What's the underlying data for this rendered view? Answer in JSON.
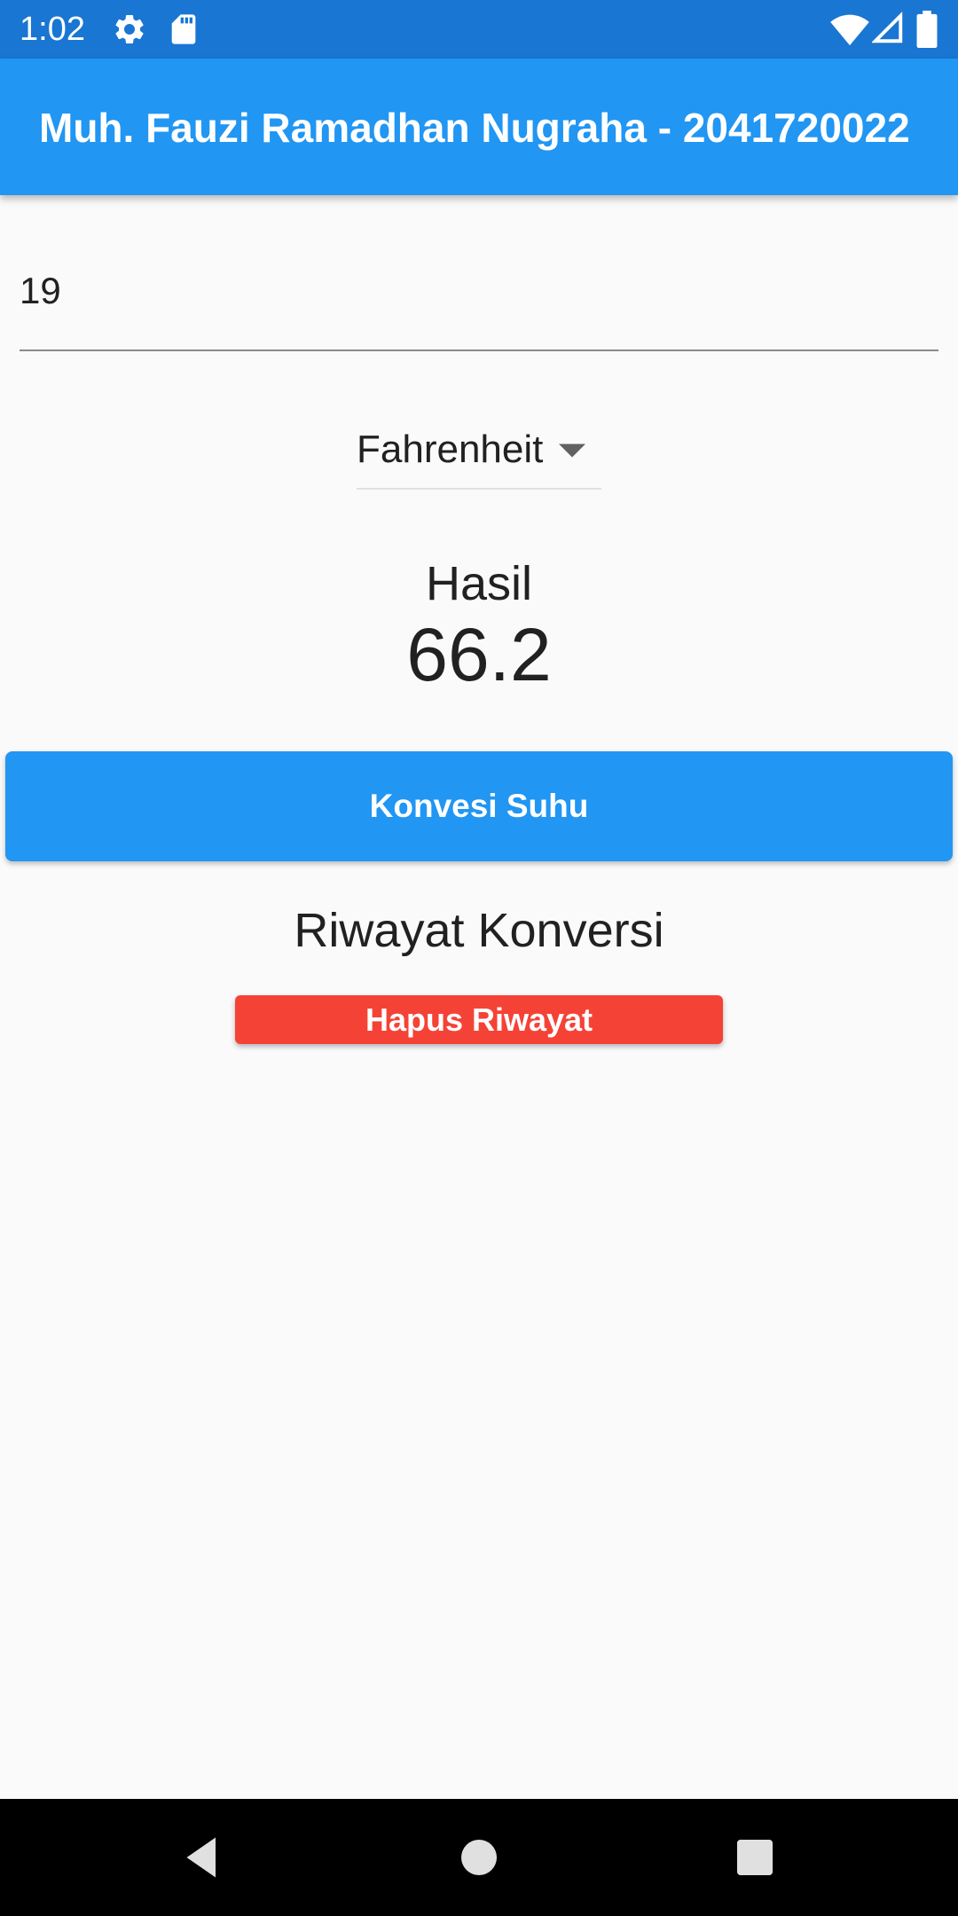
{
  "status_bar": {
    "time": "1:02",
    "icons": [
      "settings-icon",
      "sd-card-icon",
      "wifi-icon",
      "signal-icon",
      "battery-icon"
    ]
  },
  "app_bar": {
    "title": "Muh. Fauzi Ramadhan Nugraha - 2041720022"
  },
  "input": {
    "value": "19"
  },
  "dropdown": {
    "selected": "Fahrenheit",
    "icon": "arrow-drop-down-icon"
  },
  "result": {
    "label": "Hasil",
    "value": "66.2"
  },
  "convert_button": {
    "label": "Konvesi Suhu"
  },
  "history": {
    "title": "Riwayat Konversi",
    "clear_label": "Hapus Riwayat",
    "items": []
  },
  "nav_bar": {
    "icons": [
      "back-icon",
      "home-icon",
      "recents-icon"
    ]
  },
  "colors": {
    "status_bar": "#1976d2",
    "primary": "#2196f3",
    "danger": "#f44336",
    "background": "#fafafa",
    "text": "#212121"
  }
}
